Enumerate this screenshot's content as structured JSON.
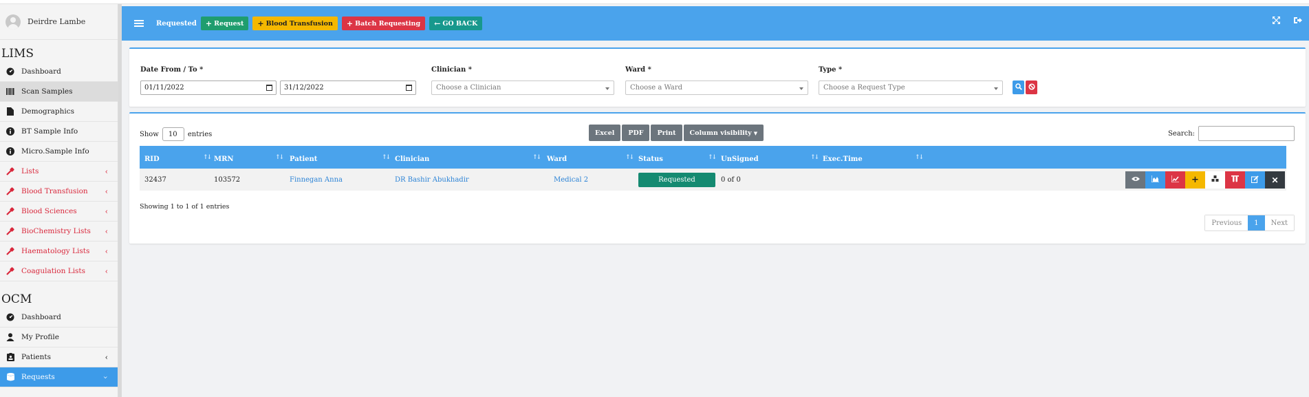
{
  "user": {
    "name": "Deirdre Lambe"
  },
  "sidebar": {
    "lims_title": "LIMS",
    "lims_items": [
      {
        "label": "Dashboard",
        "icon": "dashboard-icon"
      },
      {
        "label": "Scan Samples",
        "icon": "barcode-icon"
      },
      {
        "label": "Demographics",
        "icon": "file-icon"
      },
      {
        "label": "BT Sample Info",
        "icon": "info-icon"
      },
      {
        "label": "Micro.Sample Info",
        "icon": "info-icon"
      },
      {
        "label": "Lists",
        "icon": "eyedropper-icon"
      },
      {
        "label": "Blood Transfusion",
        "icon": "eyedropper-icon"
      },
      {
        "label": "Blood Sciences",
        "icon": "eyedropper-icon"
      },
      {
        "label": "BioChemistry Lists",
        "icon": "eyedropper-icon"
      },
      {
        "label": "Haematology Lists",
        "icon": "eyedropper-icon"
      },
      {
        "label": "Coagulation Lists",
        "icon": "eyedropper-icon"
      }
    ],
    "ocm_title": "OCM",
    "ocm_items": [
      {
        "label": "Dashboard",
        "icon": "dashboard-icon"
      },
      {
        "label": "My Profile",
        "icon": "user-icon"
      },
      {
        "label": "Patients",
        "icon": "id-badge-icon"
      },
      {
        "label": "Requests",
        "icon": "database-icon"
      }
    ]
  },
  "header": {
    "title": "Requested",
    "btn_request": "Request",
    "btn_blood_transfusion": "Blood Transfusion",
    "btn_batch_requesting": "Batch Requesting",
    "btn_go_back": "GO BACK",
    "colors": {
      "bar": "#4aa3ec",
      "green": "#1f9d6e",
      "yellow": "#f5b800",
      "red": "#dc3545",
      "teal": "#17988d"
    }
  },
  "filters": {
    "date_label": "Date From / To *",
    "date_from": "01/11/2022",
    "date_to": "31/12/2022",
    "clinician_label": "Clinician *",
    "clinician_placeholder": "Choose a Clinician",
    "ward_label": "Ward *",
    "ward_placeholder": "Choose a Ward",
    "type_label": "Type *",
    "type_placeholder": "Choose a Request Type"
  },
  "table": {
    "show_label": "Show",
    "entries_label": "entries",
    "length_value": "10",
    "buttons": {
      "excel": "Excel",
      "pdf": "PDF",
      "print": "Print",
      "colvis": "Column visibility"
    },
    "search_label": "Search:",
    "columns": [
      "RID",
      "MRN",
      "Patient",
      "Clinician",
      "Ward",
      "Status",
      "UnSigned",
      "Exec.Time"
    ],
    "rows": [
      {
        "rid": "32437",
        "mrn": "103572",
        "patient": "Finnegan Anna",
        "clinician": "DR Bashir Abukhadir",
        "ward": "Medical 2",
        "status": "Requested",
        "unsigned": "0 of 0",
        "exec_time": ""
      }
    ],
    "info": "Showing 1 to 1 of 1 entries",
    "pager": {
      "previous": "Previous",
      "current": "1",
      "next": "Next"
    }
  }
}
